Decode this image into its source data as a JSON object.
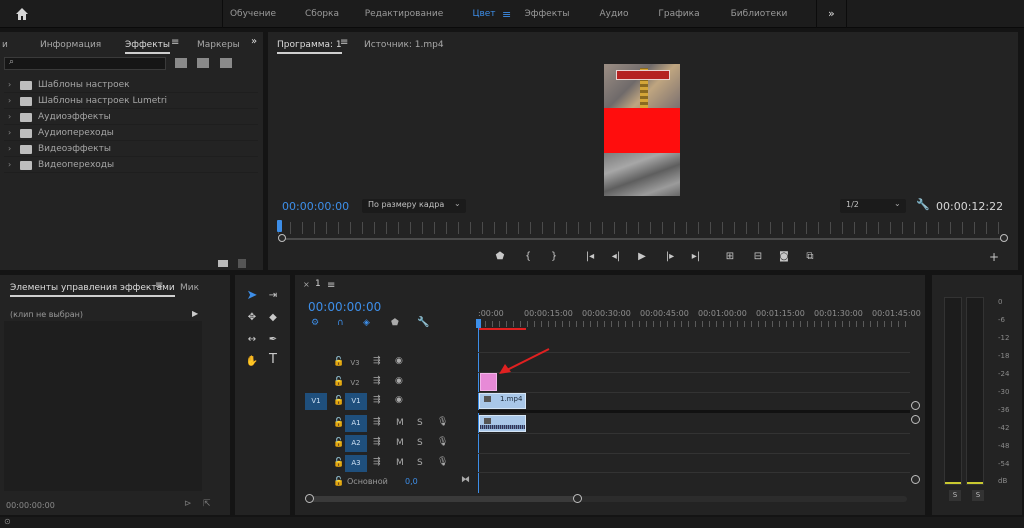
{
  "workspaces": [
    "Обучение",
    "Сборка",
    "Редактирование",
    "Цвет",
    "Эффекты",
    "Аудио",
    "Графика",
    "Библиотеки"
  ],
  "workspace_active": "Цвет",
  "effects_panel": {
    "tabs": [
      "и",
      "Информация",
      "Эффекты",
      "Маркеры"
    ],
    "active_tab": "Эффекты",
    "items": [
      "Шаблоны настроек",
      "Шаблоны настроек Lumetri",
      "Аудиоэффекты",
      "Аудиопереходы",
      "Видеоэффекты",
      "Видеопереходы"
    ]
  },
  "program_monitor": {
    "tab_program": "Программа: 1",
    "tab_source": "Источник: 1.mp4",
    "timecode_left": "00:00:00:00",
    "fit_select": "По размеру кадра",
    "quality_select": "1/2",
    "timecode_right": "00:00:12:22"
  },
  "effect_controls": {
    "tab": "Элементы управления эффектами",
    "tab2": "Мик",
    "no_clip": "(клип не выбран)",
    "timecode": "00:00:00:00"
  },
  "timeline": {
    "sequence": "1",
    "timecode": "00:00:00:00",
    "ruler": [
      ":00:00",
      "00:00:15:00",
      "00:00:30:00",
      "00:00:45:00",
      "00:01:00:00",
      "00:01:15:00",
      "00:01:30:00",
      "00:01:45:00"
    ],
    "video_tracks": [
      "V3",
      "V2",
      "V1"
    ],
    "source_patch": "V1",
    "audio_tracks": [
      "A1",
      "A2",
      "A3"
    ],
    "mute": "M",
    "solo": "S",
    "master_label": "Основной",
    "master_value": "0,0",
    "clip_name": "1.mp4"
  },
  "audio_meter": {
    "scale": [
      "0",
      "-6",
      "-12",
      "-18",
      "-24",
      "-30",
      "-36",
      "-42",
      "-48",
      "-54",
      "dB"
    ],
    "solo": [
      "S",
      "S"
    ]
  },
  "colors": {
    "accent": "#3d8ee8",
    "red_marker": "#e02020",
    "pink_clip": "#e78ad7"
  }
}
